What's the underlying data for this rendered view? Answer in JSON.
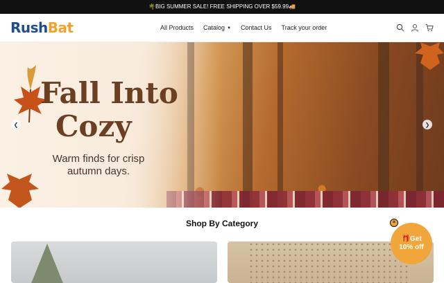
{
  "announcement": {
    "text": "BIG SUMMER SALE! FREE SHIPPING OVER $59.99"
  },
  "header": {
    "logo_part1": "Rush",
    "logo_part2": "Bat",
    "nav": [
      {
        "label": "All Products"
      },
      {
        "label": "Catalog"
      },
      {
        "label": "Contact Us"
      },
      {
        "label": "Track your order"
      }
    ],
    "icons": [
      "search-icon",
      "account-icon",
      "cart-icon"
    ]
  },
  "hero": {
    "title_line1": "Fall Into",
    "title_line2": "Cozy",
    "subtitle": "Warm finds for crisp autumn days.",
    "prev_glyph": "❮",
    "next_glyph": "❯"
  },
  "section": {
    "title": "Shop By Category"
  },
  "promo": {
    "line1": "🎁Get",
    "line2": "10% off",
    "close_glyph": "×"
  },
  "colors": {
    "brand_blue": "#1f4e8c",
    "brand_orange": "#f0a32a",
    "promo_orange": "#f0a63a",
    "announcement_bg": "#111111"
  }
}
